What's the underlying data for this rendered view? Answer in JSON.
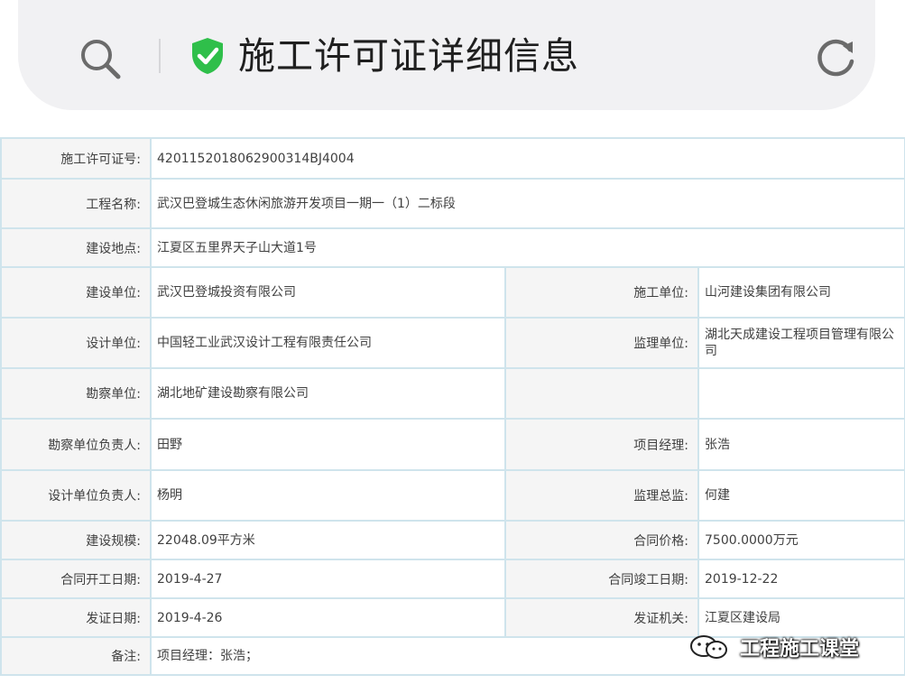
{
  "header": {
    "title": "施工许可证详细信息",
    "icons": [
      "search-icon",
      "shield-check-icon",
      "refresh-icon"
    ],
    "accent_color": "#2fbf4a"
  },
  "permit": {
    "permit_no": {
      "label": "施工许可证号:",
      "value": "4201152018062900314BJ4004"
    },
    "project_name": {
      "label": "工程名称:",
      "value": "武汉巴登城生态休闲旅游开发项目一期一（1）二标段"
    },
    "location": {
      "label": "建设地点:",
      "value": "江夏区五里界天子山大道1号"
    },
    "builder": {
      "label": "建设单位:",
      "value": "武汉巴登城投资有限公司"
    },
    "contractor": {
      "label": "施工单位:",
      "value": "山河建设集团有限公司"
    },
    "designer": {
      "label": "设计单位:",
      "value": "中国轻工业武汉设计工程有限责任公司"
    },
    "supervisor": {
      "label": "监理单位:",
      "value": "湖北天成建设工程项目管理有限公司"
    },
    "surveyor": {
      "label": "勘察单位:",
      "value": "湖北地矿建设勘察有限公司"
    },
    "survey_lead": {
      "label": "勘察单位负责人:",
      "value": "田野"
    },
    "project_manager": {
      "label": "项目经理:",
      "value": "张浩"
    },
    "design_lead": {
      "label": "设计单位负责人:",
      "value": "杨明"
    },
    "chief_supervisor": {
      "label": "监理总监:",
      "value": "何建"
    },
    "scale": {
      "label": "建设规模:",
      "value": "22048.09平方米"
    },
    "contract_price": {
      "label": "合同价格:",
      "value": "7500.0000万元"
    },
    "start_date": {
      "label": "合同开工日期:",
      "value": "2019-4-27"
    },
    "end_date": {
      "label": "合同竣工日期:",
      "value": "2019-12-22"
    },
    "issue_date": {
      "label": "发证日期:",
      "value": "2019-4-26"
    },
    "issuer": {
      "label": "发证机关:",
      "value": "江夏区建设局"
    },
    "remarks": {
      "label": "备注:",
      "value": "项目经理：张浩；"
    }
  },
  "watermark": {
    "text": "工程施工课堂",
    "icon": "wechat-icon"
  }
}
